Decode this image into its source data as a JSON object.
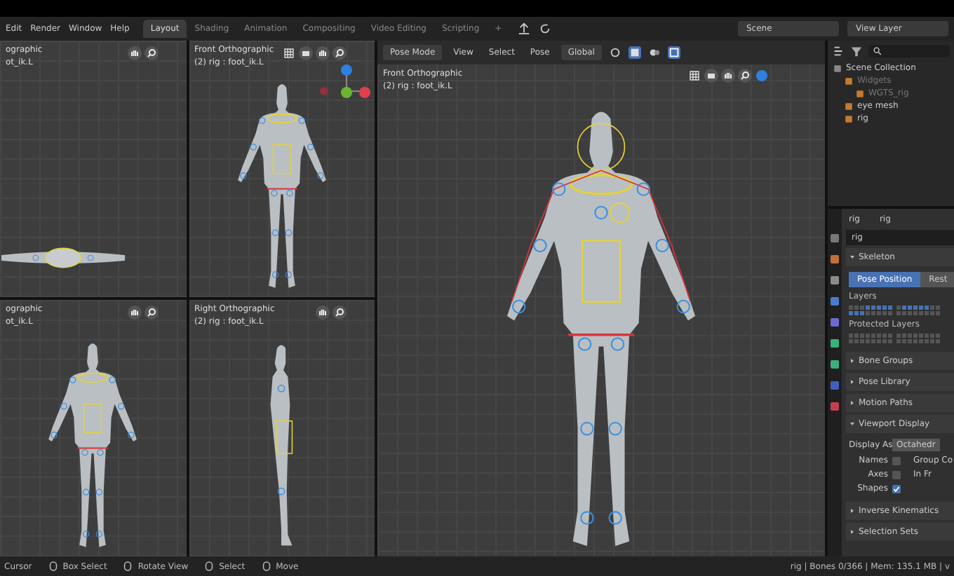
{
  "menu": [
    "Edit",
    "Render",
    "Window",
    "Help"
  ],
  "workspaces": [
    {
      "label": "Layout",
      "selected": true
    },
    {
      "label": "Shading",
      "selected": false
    },
    {
      "label": "Animation",
      "selected": false
    },
    {
      "label": "Compositing",
      "selected": false
    },
    {
      "label": "Video Editing",
      "selected": false
    },
    {
      "label": "Scripting",
      "selected": false
    }
  ],
  "add_tab": "+",
  "scene": "Scene",
  "view_layer": "View Layer",
  "quads": [
    {
      "title": "ographic",
      "subtitle": "ot_ik.L",
      "kind": "top",
      "gizmo": false
    },
    {
      "title": "Front Orthographic",
      "subtitle": "(2) rig : foot_ik.L",
      "kind": "front",
      "gizmo": true
    },
    {
      "title": "ographic",
      "subtitle": "ot_ik.L",
      "kind": "front",
      "gizmo": false
    },
    {
      "title": "Right Orthographic",
      "subtitle": "(2) rig : foot_ik.L",
      "kind": "side",
      "gizmo": false
    }
  ],
  "main": {
    "mode": "Pose Mode",
    "menus": [
      "View",
      "Select",
      "Pose"
    ],
    "orientation": "Global",
    "title": "Front Orthographic",
    "subtitle": "(2) rig : foot_ik.L"
  },
  "outliner": {
    "items": [
      {
        "label": "Scene Collection",
        "disabled": false,
        "children": [
          {
            "label": "Widgets",
            "disabled": true,
            "children": [
              {
                "label": "WGTS_rig",
                "disabled": true
              }
            ]
          },
          {
            "label": "eye mesh",
            "disabled": false
          },
          {
            "label": "rig",
            "disabled": false
          }
        ]
      }
    ]
  },
  "properties": {
    "tabs": [
      "rig",
      "rig"
    ],
    "object_field": "rig",
    "panels": [
      {
        "kind": "skeleton",
        "label": "Skeleton",
        "expanded": true
      },
      {
        "kind": "plain",
        "label": "Bone Groups",
        "expanded": false
      },
      {
        "kind": "plain",
        "label": "Pose Library",
        "expanded": false
      },
      {
        "kind": "plain",
        "label": "Motion Paths",
        "expanded": false
      },
      {
        "kind": "display",
        "label": "Viewport Display",
        "expanded": true
      },
      {
        "kind": "plain",
        "label": "Inverse Kinematics",
        "expanded": false
      },
      {
        "kind": "plain",
        "label": "Selection Sets",
        "expanded": false
      }
    ],
    "skeleton": {
      "positions": [
        {
          "label": "Pose Position",
          "selected": true
        },
        {
          "label": "Rest",
          "selected": false
        }
      ],
      "layers_label": "Layers",
      "layers": [
        false,
        false,
        false,
        true,
        true,
        true,
        true,
        true,
        true,
        true,
        true,
        false,
        false,
        false,
        false,
        false,
        false,
        true,
        true,
        true,
        true,
        true,
        false,
        false,
        false,
        false,
        false,
        false,
        false,
        false,
        false,
        false
      ],
      "protected_label": "Protected Layers",
      "protected": [
        false,
        false,
        false,
        false,
        false,
        false,
        false,
        false,
        false,
        false,
        false,
        false,
        false,
        false,
        false,
        false,
        false,
        false,
        false,
        false,
        false,
        false,
        false,
        false,
        false,
        false,
        false,
        false,
        false,
        false,
        false,
        false
      ]
    },
    "display": {
      "display_as_label": "Display As",
      "display_as": "Octahedr",
      "rows": [
        {
          "label": "Names",
          "checked": false,
          "extra": "Group Co"
        },
        {
          "label": "Axes",
          "checked": false,
          "extra": "In Fr"
        },
        {
          "label": "Shapes",
          "checked": true
        }
      ]
    }
  },
  "status": {
    "hints": [
      {
        "label": "Cursor",
        "kind": "plain"
      },
      {
        "label": "Box Select",
        "kind": "mouse"
      },
      {
        "label": "Rotate View",
        "kind": "mouse"
      },
      {
        "label": "Select",
        "kind": "mouse"
      },
      {
        "label": "Move",
        "kind": "mouse"
      }
    ],
    "info": "rig | Bones 0/366 | Mem: 135.1 MB | v"
  }
}
